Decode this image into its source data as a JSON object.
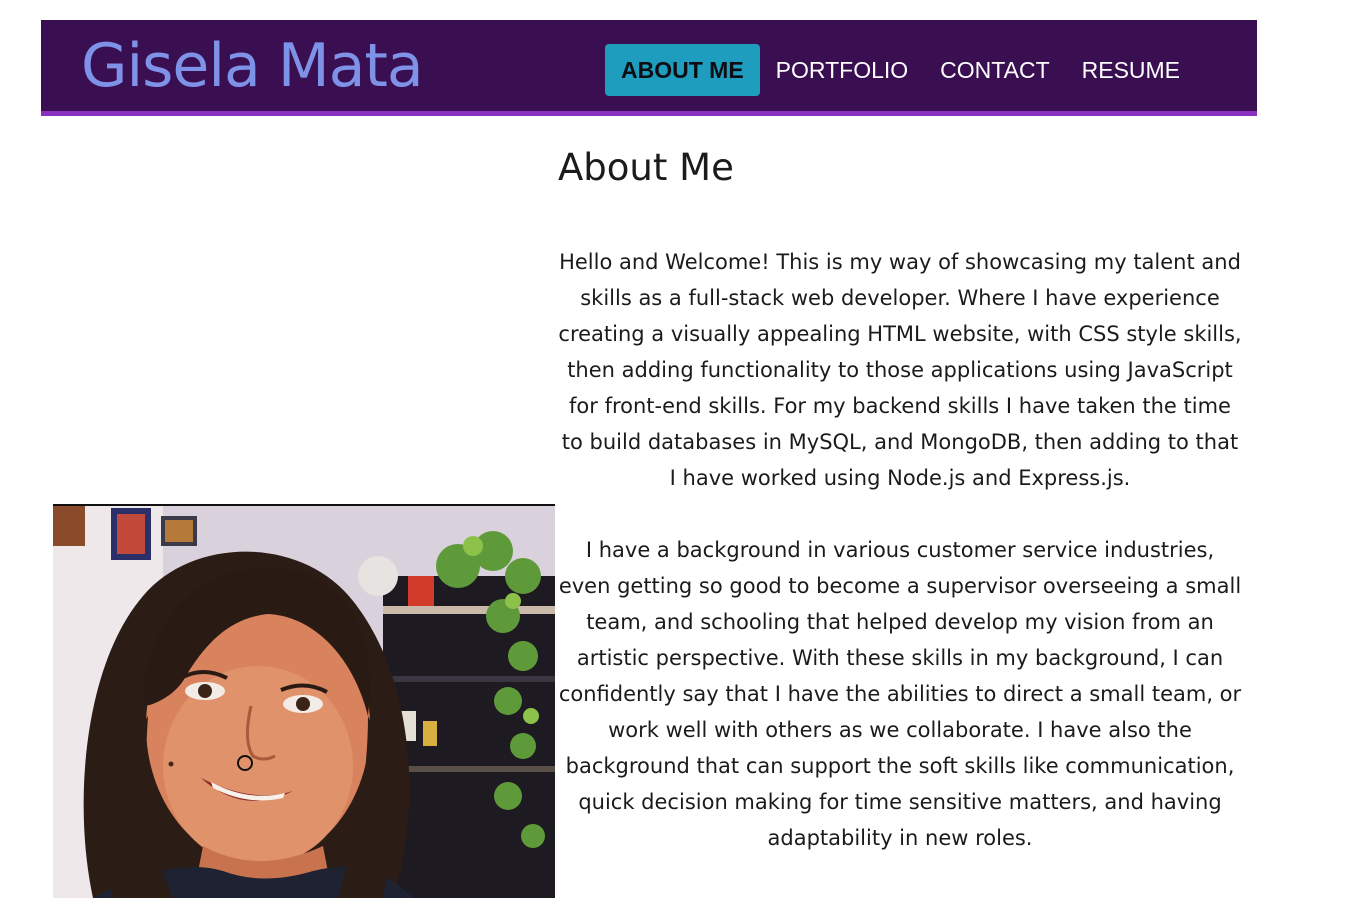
{
  "header": {
    "brand": "Gisela Mata",
    "nav": [
      {
        "label": "ABOUT ME",
        "active": true
      },
      {
        "label": "PORTFOLIO",
        "active": false
      },
      {
        "label": "CONTACT",
        "active": false
      },
      {
        "label": "RESUME",
        "active": false
      }
    ]
  },
  "main": {
    "title": "About Me",
    "paragraphs": [
      "Hello and Welcome! This is my way of showcasing my talent and skills as a full-stack web developer. Where I have experience creating a visually appealing HTML website, with CSS style skills, then adding functionality to those applications using JavaScript for front-end skills. For my backend skills I have taken the time to build databases in MySQL, and MongoDB, then adding to that I have worked using Node.js and Express.js.",
      "I have a background in various customer service industries, even getting so good to become a supervisor overseeing a small team, and schooling that helped develop my vision from an artistic perspective. With these skills in my background, I can confidently say that I have the abilities to direct a small team, or work well with others as we collaborate. I have also the background that can support the soft skills like communication, quick decision making for time sensitive matters, and having adaptability in new roles."
    ]
  },
  "colors": {
    "header_bg": "#3a0f52",
    "header_border": "#8a2fc0",
    "brand": "#7e92e8",
    "nav_active_bg": "#1f9dbe"
  }
}
